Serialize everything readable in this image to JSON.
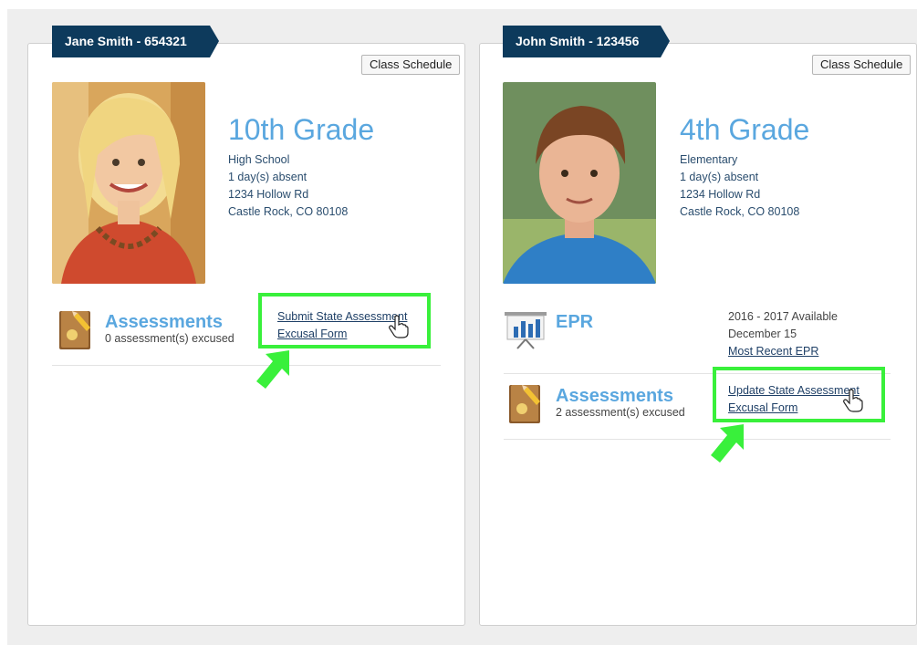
{
  "students": [
    {
      "tab_label": "Jane Smith - 654321",
      "schedule_button": "Class Schedule",
      "grade": "10th Grade",
      "school": "High School",
      "absences": "1 day(s) absent",
      "address1": "1234 Hollow Rd",
      "address2": "Castle Rock, CO 80108",
      "assessments": {
        "title": "Assessments",
        "excused": "0 assessment(s) excused",
        "link_line1": "Submit State Assessment",
        "link_line2": "Excusal Form"
      }
    },
    {
      "tab_label": "John Smith - 123456",
      "schedule_button": "Class Schedule",
      "grade": "4th Grade",
      "school": "Elementary",
      "absences": "1 day(s) absent",
      "address1": "1234 Hollow Rd",
      "address2": "Castle Rock, CO 80108",
      "epr": {
        "title": "EPR",
        "available": "2016 - 2017 Available",
        "date": "December 15",
        "link": "Most Recent EPR"
      },
      "assessments": {
        "title": "Assessments",
        "excused": "2 assessment(s) excused",
        "link_line1": "Update State Assessment",
        "link_line2": "Excusal Form"
      }
    }
  ],
  "colors": {
    "tab_bg": "#0d3a5c",
    "accent_blue": "#5aa7df",
    "highlight_green": "#39f03b",
    "link_navy": "#1e3f66"
  }
}
